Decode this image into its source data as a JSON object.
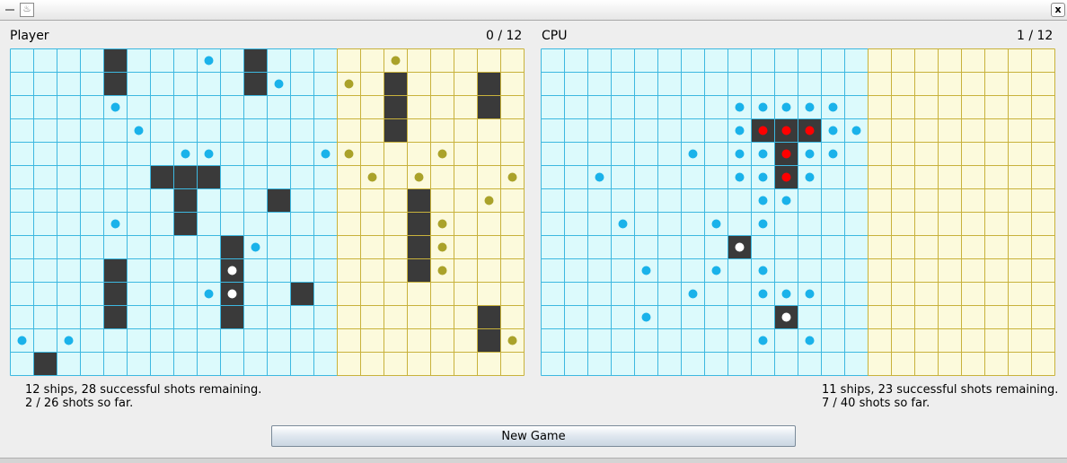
{
  "window": {
    "minimize_icon": "minimize-icon",
    "app_icon": "java-app-icon",
    "close_icon": "close-icon",
    "close_glyph": "x"
  },
  "player": {
    "name": "Player",
    "score": "0 / 12",
    "status_ships": "12 ships, 28 successful shots remaining.",
    "status_shots": "2 / 26 shots so far.",
    "own_ships": [
      [
        4,
        0
      ],
      [
        4,
        1
      ],
      [
        10,
        0
      ],
      [
        10,
        1
      ],
      [
        6,
        5
      ],
      [
        7,
        5
      ],
      [
        8,
        5
      ],
      [
        7,
        6
      ],
      [
        7,
        7
      ],
      [
        11,
        6
      ],
      [
        9,
        8
      ],
      [
        9,
        9
      ],
      [
        9,
        10
      ],
      [
        9,
        11
      ],
      [
        4,
        9
      ],
      [
        4,
        10
      ],
      [
        4,
        11
      ],
      [
        12,
        10
      ],
      [
        1,
        13
      ],
      [
        16,
        1
      ],
      [
        16,
        2
      ],
      [
        16,
        3
      ],
      [
        20,
        1
      ],
      [
        20,
        2
      ],
      [
        17,
        6
      ],
      [
        17,
        7
      ],
      [
        17,
        8
      ],
      [
        17,
        9
      ],
      [
        20,
        11
      ],
      [
        20,
        12
      ]
    ],
    "misses_left": [
      [
        8,
        0
      ],
      [
        11,
        1
      ],
      [
        4,
        2
      ],
      [
        5,
        3
      ],
      [
        7,
        4
      ],
      [
        8,
        4
      ],
      [
        13,
        4
      ],
      [
        4,
        7
      ],
      [
        10,
        8
      ],
      [
        8,
        10
      ],
      [
        0,
        12
      ],
      [
        2,
        12
      ]
    ],
    "hits_left": [
      [
        9,
        9
      ],
      [
        9,
        10
      ]
    ],
    "misses_right": [
      [
        16,
        0
      ],
      [
        14,
        1
      ],
      [
        14,
        4
      ],
      [
        18,
        4
      ],
      [
        15,
        5
      ],
      [
        17,
        5
      ],
      [
        21,
        5
      ],
      [
        20,
        6
      ],
      [
        18,
        7
      ],
      [
        18,
        8
      ],
      [
        18,
        9
      ],
      [
        21,
        12
      ]
    ]
  },
  "cpu": {
    "name": "CPU",
    "score": "1 / 12",
    "status_ships": "11 ships, 23 successful shots remaining.",
    "status_shots": "7 / 40 shots so far.",
    "own_ships": [
      [
        9,
        3
      ],
      [
        10,
        3
      ],
      [
        11,
        3
      ],
      [
        10,
        4
      ],
      [
        10,
        5
      ],
      [
        8,
        8
      ],
      [
        10,
        11
      ]
    ],
    "sunk": [
      [
        9,
        3
      ],
      [
        10,
        3
      ],
      [
        11,
        3
      ],
      [
        10,
        4
      ],
      [
        10,
        5
      ]
    ],
    "misses_left": [
      [
        8,
        2
      ],
      [
        9,
        2
      ],
      [
        10,
        2
      ],
      [
        11,
        2
      ],
      [
        12,
        2
      ],
      [
        8,
        3
      ],
      [
        12,
        3
      ],
      [
        13,
        3
      ],
      [
        6,
        4
      ],
      [
        8,
        4
      ],
      [
        9,
        4
      ],
      [
        11,
        4
      ],
      [
        12,
        4
      ],
      [
        2,
        5
      ],
      [
        8,
        5
      ],
      [
        9,
        5
      ],
      [
        11,
        5
      ],
      [
        9,
        6
      ],
      [
        10,
        6
      ],
      [
        3,
        7
      ],
      [
        7,
        7
      ],
      [
        9,
        7
      ],
      [
        4,
        9
      ],
      [
        7,
        9
      ],
      [
        9,
        9
      ],
      [
        6,
        10
      ],
      [
        9,
        10
      ],
      [
        10,
        10
      ],
      [
        11,
        10
      ],
      [
        4,
        11
      ],
      [
        9,
        12
      ],
      [
        11,
        12
      ]
    ],
    "hits_left": [
      [
        8,
        8
      ],
      [
        10,
        11
      ]
    ],
    "misses_right": []
  },
  "buttons": {
    "new_game": "New Game"
  },
  "colors": {
    "sea": "#dcfafc",
    "sea_line": "#3db8e0",
    "sand": "#fcfadc",
    "sand_line": "#c8b23c",
    "ship": "#3a3a3a",
    "miss_blue": "#1ab2ea",
    "miss_olive": "#aaa22a",
    "hit_white": "#ffffff",
    "sunk_red": "#ff0000"
  }
}
